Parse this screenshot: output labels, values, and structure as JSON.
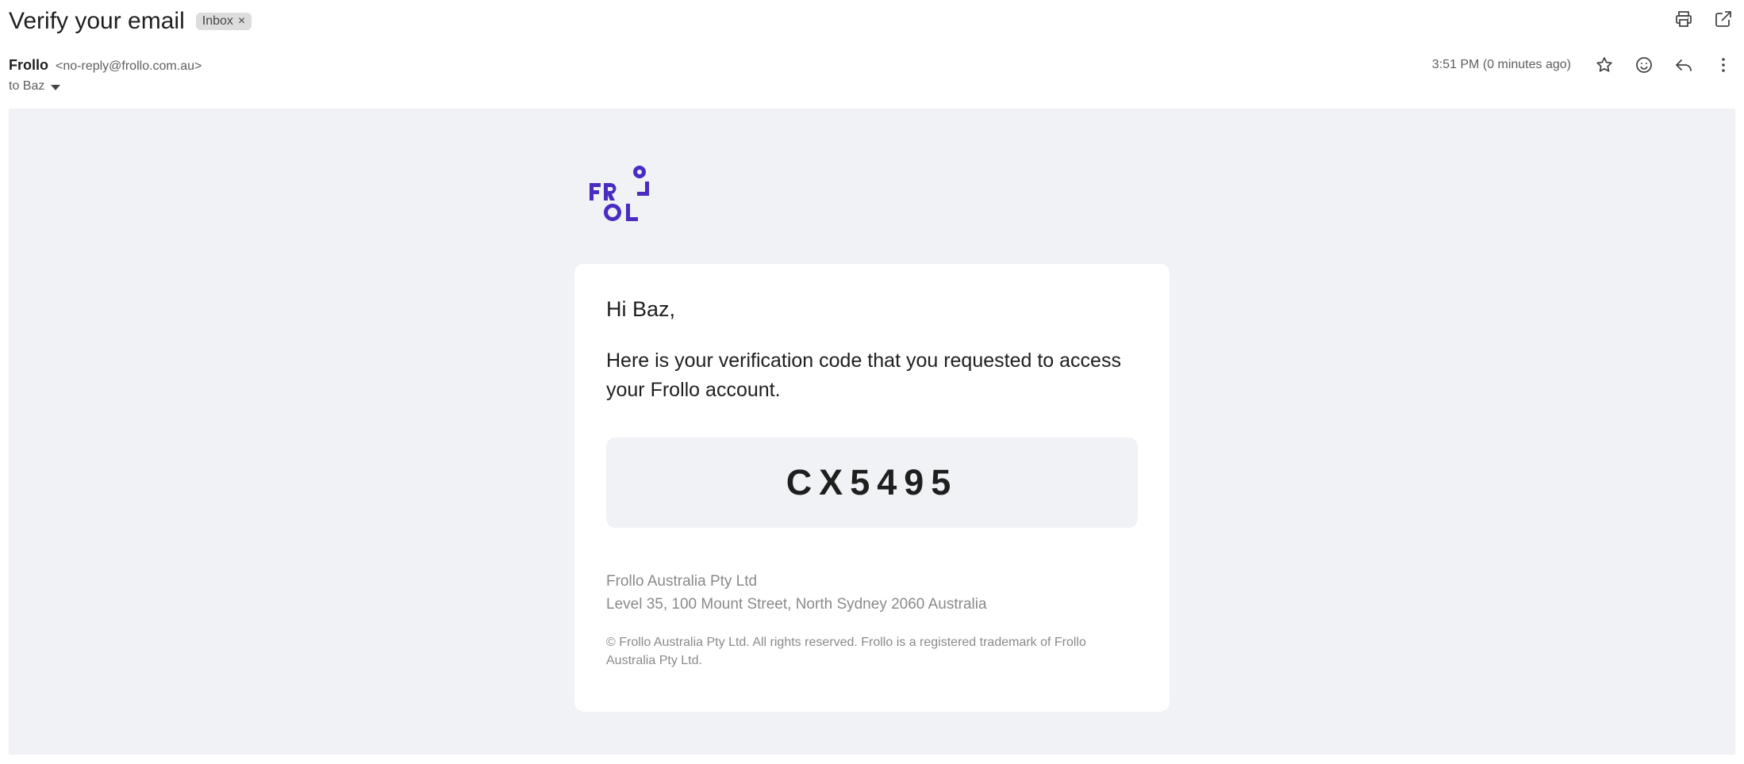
{
  "subject": "Verify your email",
  "label_chip": {
    "text": "Inbox",
    "close": "×"
  },
  "sender": {
    "name": "Frollo",
    "email": "<no-reply@frollo.com.au>"
  },
  "recipient": "to Baz",
  "timestamp": "3:51 PM (0 minutes ago)",
  "icons": {
    "print": "print-icon",
    "open_new_window": "open-in-new-window-icon",
    "star": "star-icon",
    "emoji": "emoji-reaction-icon",
    "reply": "reply-icon",
    "more": "more-vertical-icon",
    "caret": "chevron-down-icon"
  },
  "brand": {
    "logo_text": "FROLLO",
    "color": "#4a2cc0"
  },
  "card": {
    "greeting": "Hi Baz,",
    "message": "Here is your verification code that you requested to access your Frollo account.",
    "code": "CX5495",
    "company_name": "Frollo Australia Pty Ltd",
    "company_address": "Level 35, 100 Mount Street, North Sydney 2060 Australia",
    "copyright": "© Frollo Australia Pty Ltd. All rights reserved. Frollo is a registered trademark of Frollo Australia Pty Ltd."
  },
  "colors": {
    "body_bg": "#f1f2f6",
    "card_bg": "#ffffff",
    "muted_text": "#8a8a8a"
  }
}
